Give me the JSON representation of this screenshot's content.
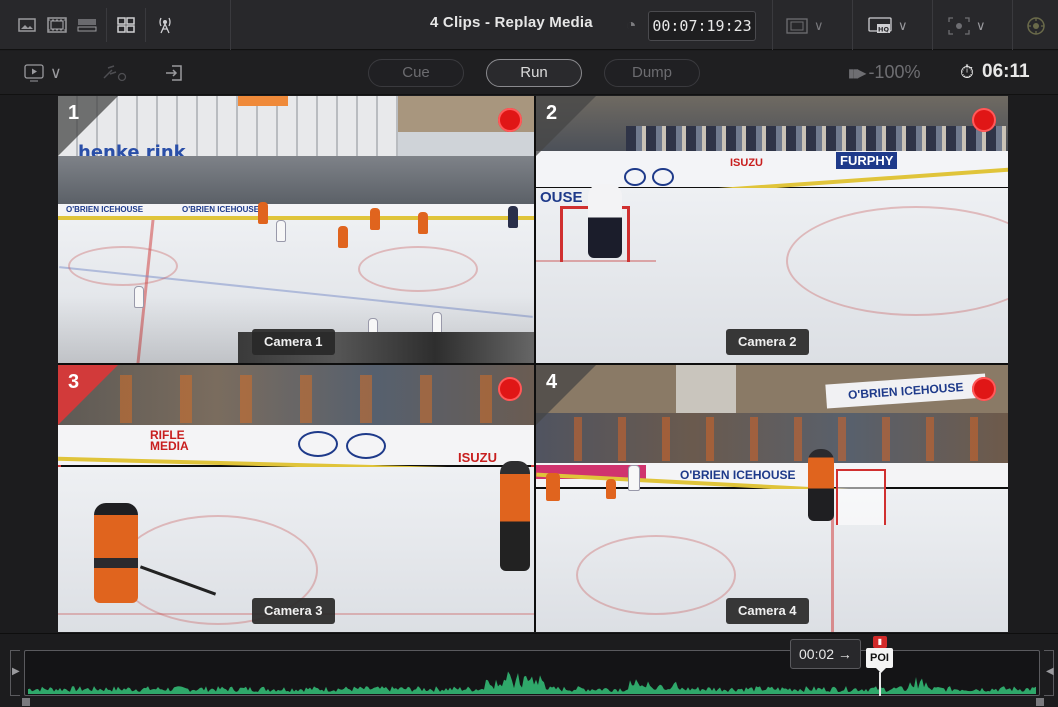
{
  "header": {
    "title": "4 Clips - Replay Media",
    "timecode": "00:07:19:23"
  },
  "transport": {
    "cue_label": "Cue",
    "run_label": "Run",
    "dump_label": "Dump",
    "speed": "-100%",
    "timer": "06:11"
  },
  "multiview": {
    "tiles": [
      {
        "number": "1",
        "label": "Camera 1"
      },
      {
        "number": "2",
        "label": "Camera 2"
      },
      {
        "number": "3",
        "label": "Camera 3"
      },
      {
        "number": "4",
        "label": "Camera 4"
      }
    ],
    "selected": "3"
  },
  "scenes": {
    "cam1_banner": "henke rink",
    "cam1_board_a": "O'BRIEN ICEHOUSE",
    "cam1_board_b": "O'BRIEN ICEHOUSE",
    "cam2_board_a": "FURPHY",
    "cam2_board_b": "ISUZU",
    "cam2_board_c": "OUSE",
    "cam3_board_a": "RIFLE MEDIA",
    "cam3_board_b": "ISUZU",
    "cam4_board_a": "O'BRIEN ICEHOUSE",
    "cam4_board_b": "O'BRIEN ICEHOUSE"
  },
  "timeline": {
    "duration": "00:02 →",
    "marker": "POI"
  },
  "colors": {
    "record": "#e01616",
    "selected_border": "#d23a3a",
    "waveform": "#2fa86a",
    "ice_line": "#d24646"
  }
}
